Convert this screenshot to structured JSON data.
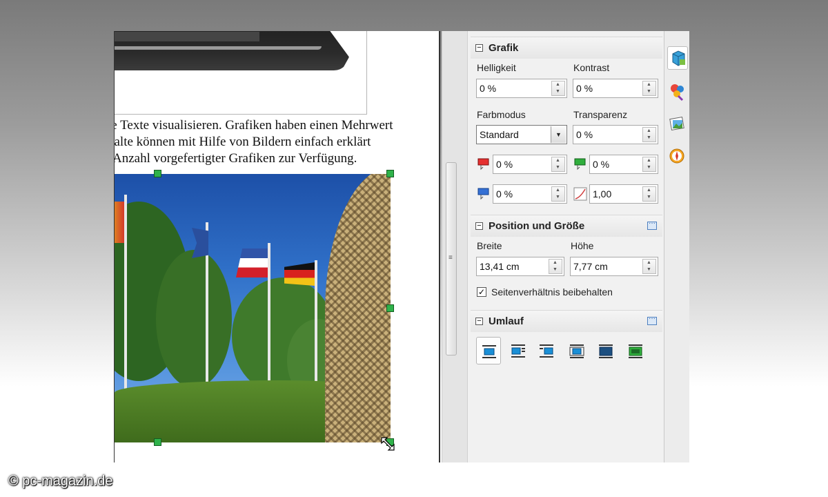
{
  "document": {
    "lines": [
      "ie Texte visualisieren. Grafiken haben einen Mehrwert",
      "halte können mit Hilfe von Bildern einfach erklärt",
      "Anzahl vorgefertigter Grafiken zur Verfügung."
    ]
  },
  "sidebar": {
    "grafik": {
      "title": "Grafik",
      "helligkeit_label": "Helligkeit",
      "helligkeit_value": "0 %",
      "kontrast_label": "Kontrast",
      "kontrast_value": "0 %",
      "farbmodus_label": "Farbmodus",
      "farbmodus_value": "Standard",
      "transparenz_label": "Transparenz",
      "transparenz_value": "0 %",
      "red_value": "0 %",
      "green_value": "0 %",
      "blue_value": "0 %",
      "gamma_value": "1,00"
    },
    "position": {
      "title": "Position und Größe",
      "breite_label": "Breite",
      "breite_value": "13,41 cm",
      "hoehe_label": "Höhe",
      "hoehe_value": "7,77 cm",
      "keep_ratio_label": "Seitenverhältnis beibehalten",
      "keep_ratio_checked": true
    },
    "umlauf": {
      "title": "Umlauf"
    }
  },
  "watermark": "© pc-magazin.de"
}
